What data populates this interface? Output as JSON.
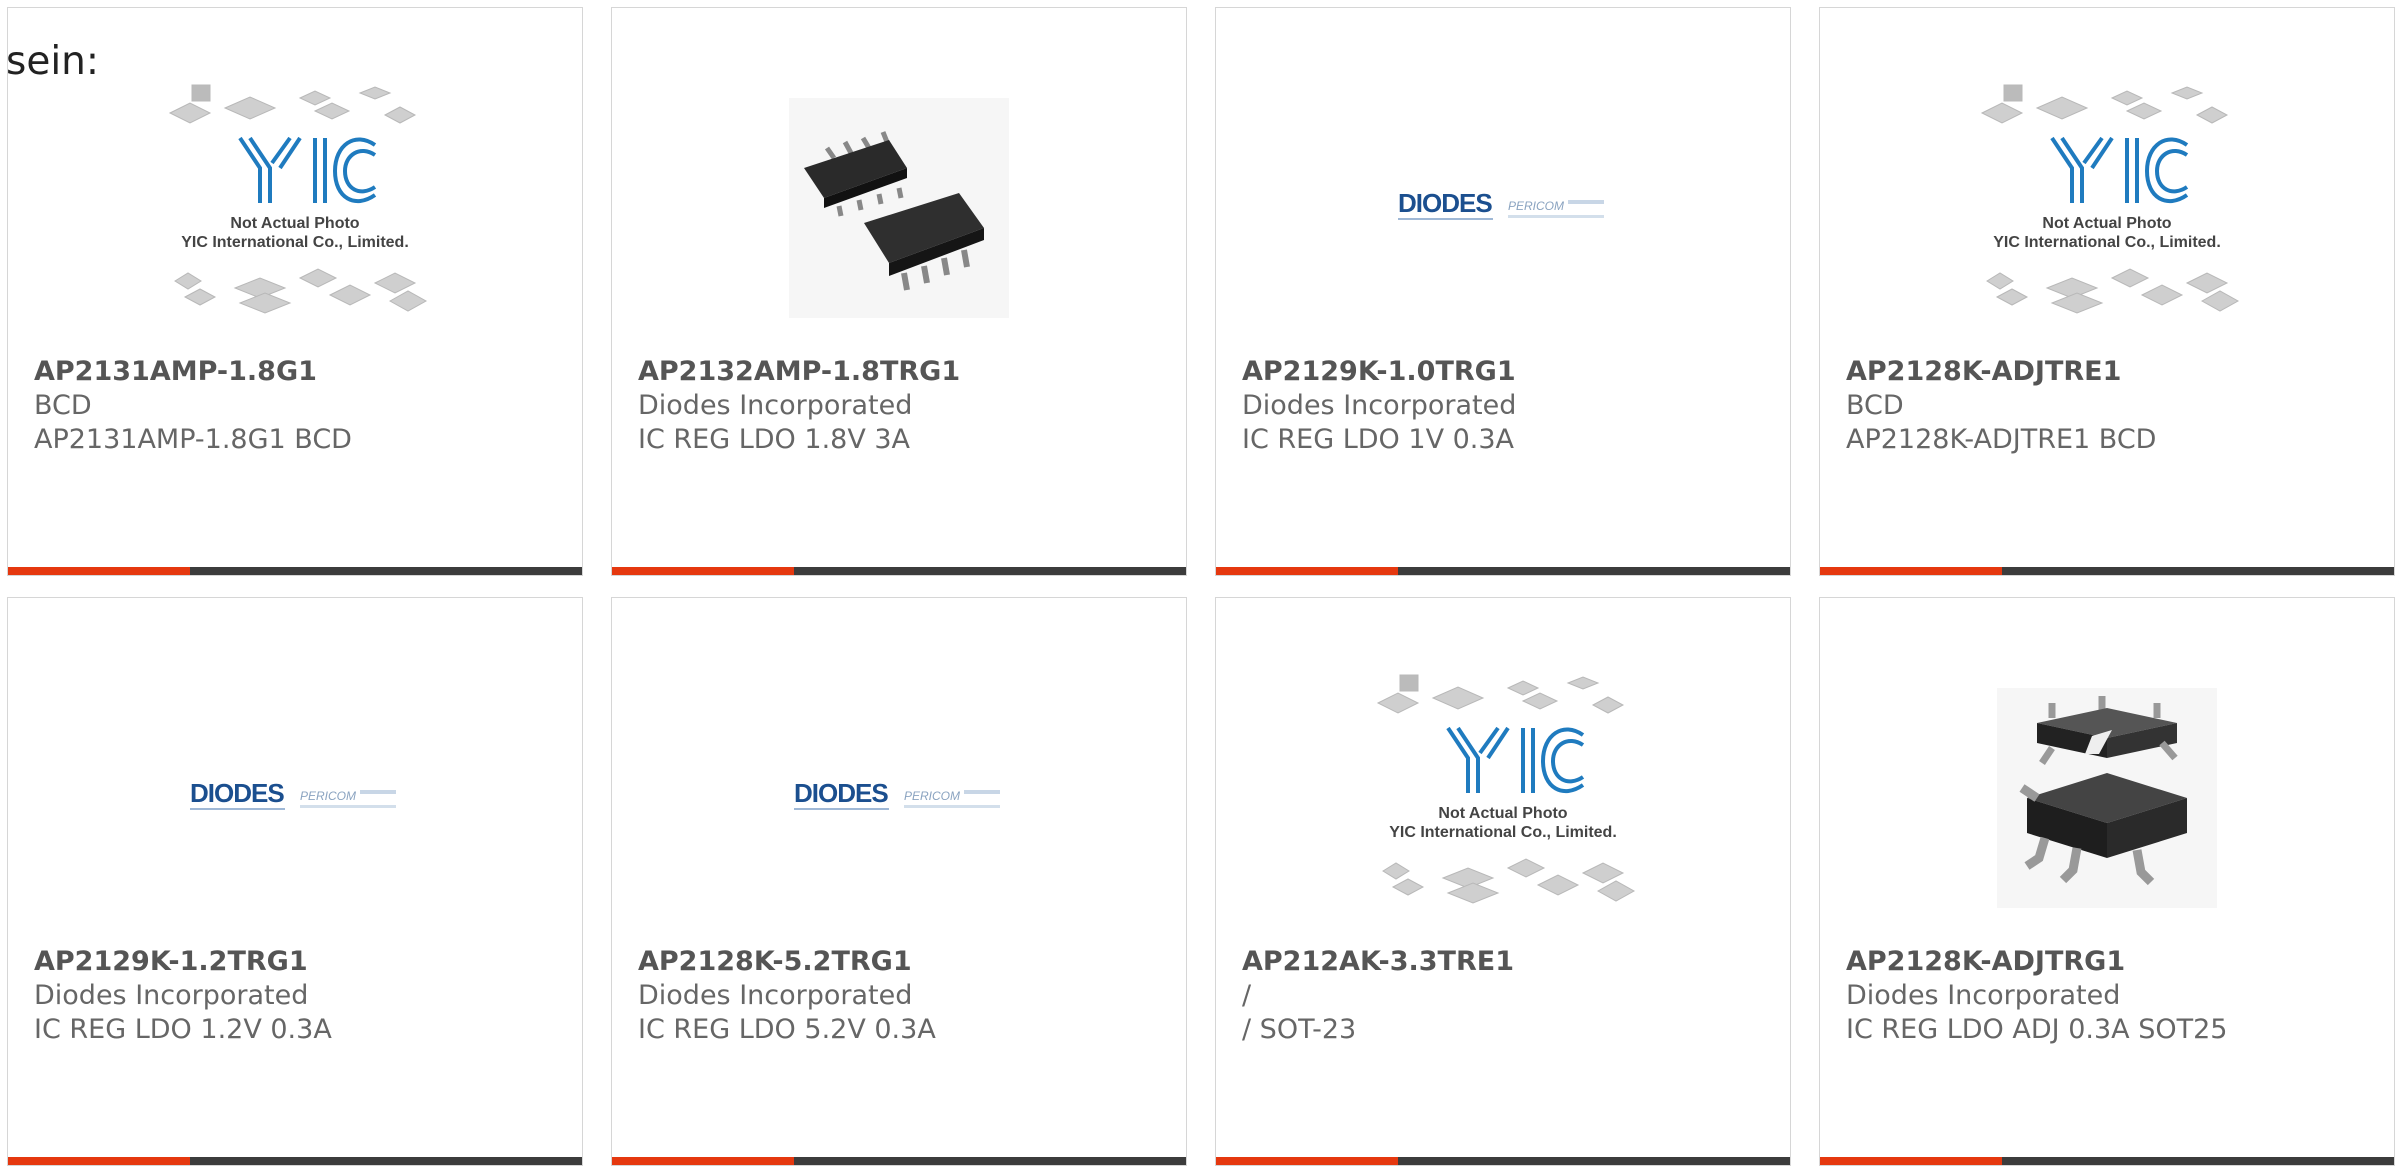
{
  "intro_text": "sein:",
  "colors": {
    "accent": "#e5380f",
    "bar": "#3c3c3c",
    "card_border": "#d6d6d6"
  },
  "placeholder_logo": {
    "brand": "YIC",
    "line1": "Not Actual Photo",
    "line2": "YIC International Co., Limited."
  },
  "diodes_logo": {
    "brand": "DIODES",
    "sub": "PERICOM"
  },
  "products": [
    {
      "part": "AP2131AMP-1.8G1",
      "manufacturer": "BCD",
      "description": "AP2131AMP-1.8G1 BCD",
      "image": "yic-placeholder"
    },
    {
      "part": "AP2132AMP-1.8TRG1",
      "manufacturer": "Diodes Incorporated",
      "description": "IC REG LDO 1.8V 3A",
      "image": "soic8-chip"
    },
    {
      "part": "AP2129K-1.0TRG1",
      "manufacturer": "Diodes Incorporated",
      "description": "IC REG LDO 1V 0.3A",
      "image": "diodes-logo"
    },
    {
      "part": "AP2128K-ADJTRE1",
      "manufacturer": "BCD",
      "description": "AP2128K-ADJTRE1 BCD",
      "image": "yic-placeholder"
    },
    {
      "part": "AP2129K-1.2TRG1",
      "manufacturer": "Diodes Incorporated",
      "description": "IC REG LDO 1.2V 0.3A",
      "image": "diodes-logo"
    },
    {
      "part": "AP2128K-5.2TRG1",
      "manufacturer": "Diodes Incorporated",
      "description": "IC REG LDO 5.2V 0.3A",
      "image": "diodes-logo"
    },
    {
      "part": "AP212AK-3.3TRE1",
      "manufacturer": "/",
      "description": "/ SOT-23",
      "image": "yic-placeholder"
    },
    {
      "part": "AP2128K-ADJTRG1",
      "manufacturer": "Diodes Incorporated",
      "description": "IC REG LDO ADJ 0.3A SOT25",
      "image": "sot25-chip"
    }
  ]
}
